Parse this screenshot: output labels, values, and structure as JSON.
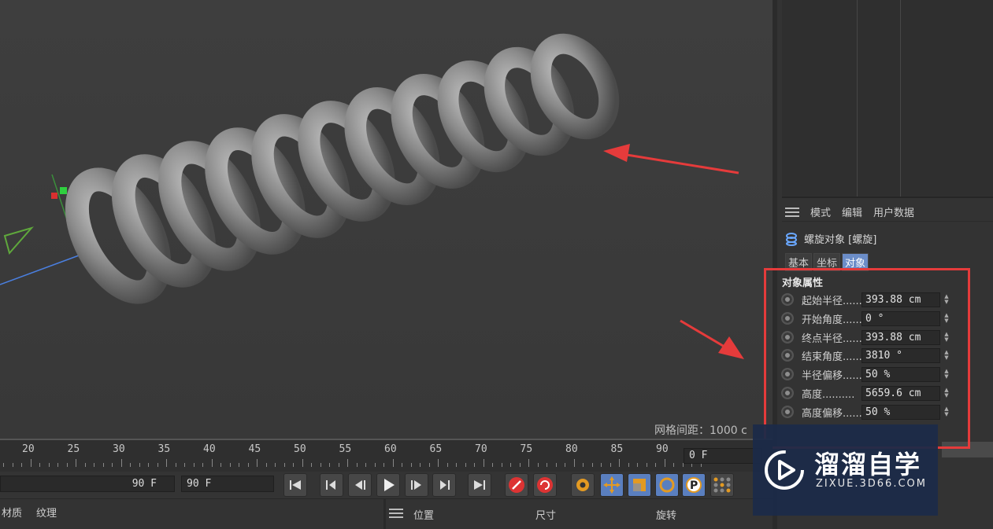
{
  "viewport": {
    "grid_spacing_label": "网格间距：1000 c"
  },
  "attribute_manager": {
    "menu": [
      "模式",
      "编辑",
      "用户数据"
    ],
    "object_title": "螺旋对象 [螺旋]",
    "tabs": [
      {
        "label": "基本",
        "active": false
      },
      {
        "label": "坐标",
        "active": false
      },
      {
        "label": "对象",
        "active": true
      }
    ],
    "section_header": "对象属性",
    "properties": [
      {
        "label": "起始半径......",
        "value": "393.88 cm"
      },
      {
        "label": "开始角度......",
        "value": "0 °"
      },
      {
        "label": "终点半径......",
        "value": "393.88 cm"
      },
      {
        "label": "结束角度......",
        "value": "3810 °"
      },
      {
        "label": "半径偏移......",
        "value": "50 %"
      },
      {
        "label": "高度..........",
        "value": "5659.6 cm"
      },
      {
        "label": "高度偏移......",
        "value": "50 %"
      }
    ]
  },
  "timeline": {
    "ticks": [
      "20",
      "25",
      "30",
      "35",
      "40",
      "45",
      "50",
      "55",
      "60",
      "65",
      "70",
      "75",
      "80",
      "85",
      "90"
    ],
    "current_frame": "0 F"
  },
  "transport": {
    "end_frame": "90 F",
    "max_frame": "90 F",
    "buttons": [
      "go-to-start",
      "previous-key",
      "previous-frame",
      "play",
      "next-frame",
      "next-key",
      "go-to-end",
      "record",
      "autokey",
      "keyframe-settings",
      "move",
      "scale",
      "rotate",
      "parameter",
      "point-level"
    ]
  },
  "bottom_managers": {
    "material_menu": [
      "材质",
      "纹理"
    ],
    "coordinate_headers": [
      "位置",
      "尺寸",
      "旋转"
    ]
  },
  "watermark": {
    "title": "溜溜自学",
    "url": "ZIXUE.3D66.COM"
  },
  "colors": {
    "annotation_red": "#e53b3b",
    "active_tab": "#6b8dc8",
    "watermark_bg": "#1c2a48"
  }
}
